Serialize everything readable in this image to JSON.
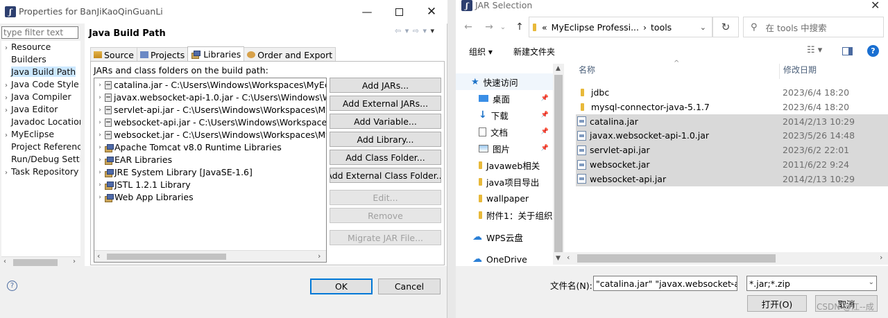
{
  "props": {
    "title": "Properties for BanJiKaoQinGuanLi",
    "filter_placeholder": "type filter text",
    "nav": [
      {
        "label": "Resource",
        "expandable": true,
        "selected": false
      },
      {
        "label": "Builders",
        "expandable": false,
        "selected": false
      },
      {
        "label": "Java Build Path",
        "expandable": false,
        "selected": true
      },
      {
        "label": "Java Code Style",
        "expandable": true,
        "selected": false
      },
      {
        "label": "Java Compiler",
        "expandable": true,
        "selected": false
      },
      {
        "label": "Java Editor",
        "expandable": true,
        "selected": false
      },
      {
        "label": "Javadoc Location",
        "expandable": false,
        "selected": false
      },
      {
        "label": "MyEclipse",
        "expandable": true,
        "selected": false
      },
      {
        "label": "Project References",
        "expandable": false,
        "selected": false
      },
      {
        "label": "Run/Debug Settings",
        "expandable": false,
        "selected": false
      },
      {
        "label": "Task Repository",
        "expandable": true,
        "selected": false
      }
    ],
    "page_title": "Java Build Path",
    "tabs": [
      "Source",
      "Projects",
      "Libraries",
      "Order and Export"
    ],
    "active_tab": "Libraries",
    "list_caption": "JARs and class folders on the build path:",
    "libs": [
      {
        "label": "catalina.jar - C:\\Users\\Windows\\Workspaces\\MyEclipse",
        "kind": "jar"
      },
      {
        "label": "javax.websocket-api-1.0.jar - C:\\Users\\Windows\\Workspaces",
        "kind": "jar"
      },
      {
        "label": "servlet-api.jar - C:\\Users\\Windows\\Workspaces\\MyEclipse",
        "kind": "jar"
      },
      {
        "label": "websocket-api.jar - C:\\Users\\Windows\\Workspaces\\MyEclipse",
        "kind": "jar"
      },
      {
        "label": "websocket.jar - C:\\Users\\Windows\\Workspaces\\MyEclipse",
        "kind": "jar"
      },
      {
        "label": "Apache Tomcat v8.0 Runtime Libraries",
        "kind": "lib"
      },
      {
        "label": "EAR Libraries",
        "kind": "lib"
      },
      {
        "label": "JRE System Library [JavaSE-1.6]",
        "kind": "lib"
      },
      {
        "label": "JSTL 1.2.1 Library",
        "kind": "lib"
      },
      {
        "label": "Web App Libraries",
        "kind": "lib"
      }
    ],
    "buttons": {
      "add_jars": "Add JARs...",
      "add_external_jars": "Add External JARs...",
      "add_variable": "Add Variable...",
      "add_library": "Add Library...",
      "add_class_folder": "Add Class Folder...",
      "add_external_class_folder": "Add External Class Folder...",
      "edit": "Edit...",
      "remove": "Remove",
      "migrate": "Migrate JAR File...",
      "ok": "OK",
      "cancel": "Cancel"
    },
    "help_glyph": "?"
  },
  "jar": {
    "title": "JAR Selection",
    "breadcrumb": {
      "prefix": "«",
      "parent": "MyEclipse Professi...",
      "sep": "›",
      "current": "tools"
    },
    "search_placeholder": "在 tools 中搜索",
    "toolbar": {
      "organize": "组织 ▾",
      "new_folder": "新建文件夹"
    },
    "nav": [
      {
        "label": "快速访问",
        "kind": "star"
      },
      {
        "label": "桌面",
        "kind": "desktop",
        "pinned": true
      },
      {
        "label": "下载",
        "kind": "download",
        "pinned": true
      },
      {
        "label": "文档",
        "kind": "doc",
        "pinned": true
      },
      {
        "label": "图片",
        "kind": "pic",
        "pinned": true
      },
      {
        "label": "Javaweb相关",
        "kind": "folder"
      },
      {
        "label": "java项目导出",
        "kind": "folder"
      },
      {
        "label": "wallpaper",
        "kind": "folder"
      },
      {
        "label": "附件1：关于组织",
        "kind": "folder"
      },
      {
        "label": "WPS云盘",
        "kind": "cloud"
      },
      {
        "label": "OneDrive",
        "kind": "cloud"
      }
    ],
    "columns": {
      "name": "名称",
      "modified": "修改日期"
    },
    "files": [
      {
        "name": "jdbc",
        "date": "2023/6/4 18:20",
        "kind": "folder",
        "selected": false
      },
      {
        "name": "mysql-connector-java-5.1.7",
        "date": "2023/6/4 18:20",
        "kind": "folder",
        "selected": false
      },
      {
        "name": "catalina.jar",
        "date": "2014/2/13 10:29",
        "kind": "jar",
        "selected": true
      },
      {
        "name": "javax.websocket-api-1.0.jar",
        "date": "2023/5/26 14:48",
        "kind": "jar",
        "selected": true
      },
      {
        "name": "servlet-api.jar",
        "date": "2023/6/2 22:01",
        "kind": "jar",
        "selected": true
      },
      {
        "name": "websocket.jar",
        "date": "2011/6/22 9:24",
        "kind": "jar",
        "selected": true
      },
      {
        "name": "websocket-api.jar",
        "date": "2014/2/13 10:29",
        "kind": "jar",
        "selected": true
      }
    ],
    "filename_label": "文件名(N):",
    "filename_value": "\"catalina.jar\" \"javax.websocket-ap",
    "filter_value": "*.jar;*.zip",
    "open_button": "打开(O)",
    "cancel_button": "取消",
    "watermark": "CSDN @江--成"
  }
}
